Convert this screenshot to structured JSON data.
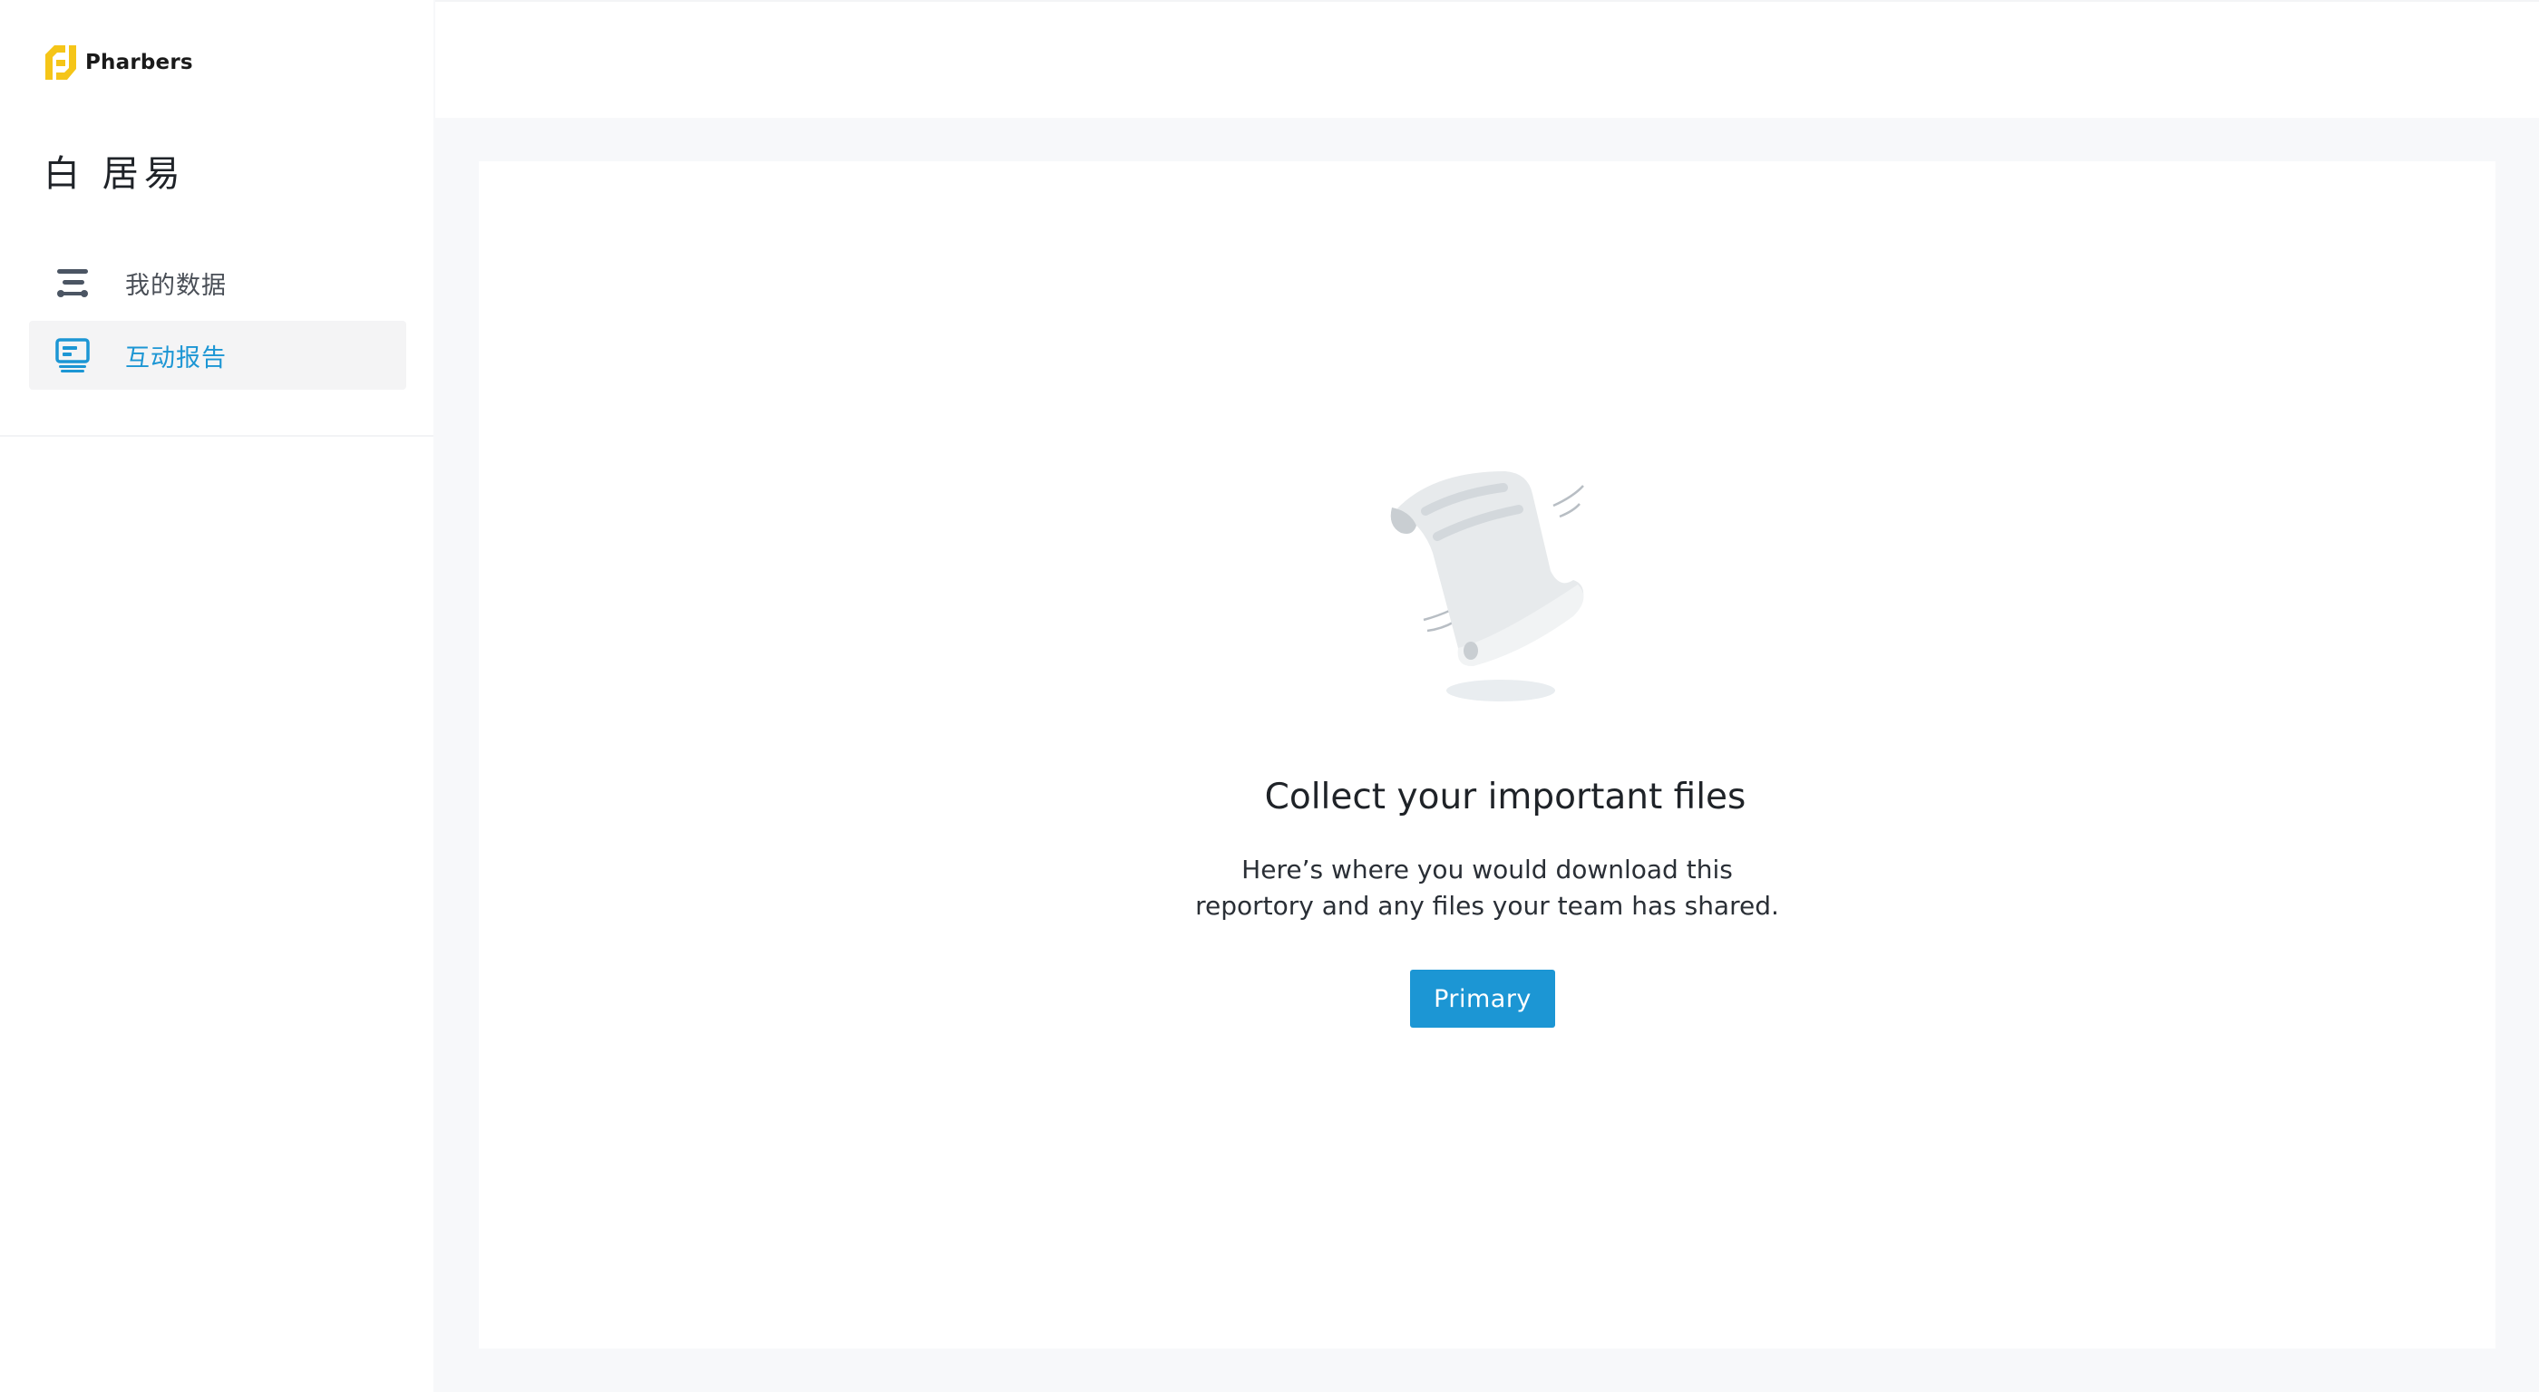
{
  "brand": {
    "name": "Pharbers",
    "logo_icon": "pharbers-logo-icon",
    "logo_color": "#f5c518"
  },
  "user": {
    "name": "白 居易"
  },
  "sidebar": {
    "items": [
      {
        "label": "我的数据",
        "icon": "data-flow-icon",
        "active": false
      },
      {
        "label": "互动报告",
        "icon": "report-icon",
        "active": true
      }
    ]
  },
  "empty_state": {
    "illustration": "scroll-paper-icon",
    "title": "Collect your important files",
    "description_line1": "Here’s where you would download this",
    "description_line2": "reportory and any files your team has shared.",
    "button_label": "Primary"
  },
  "colors": {
    "accent": "#1c96d4",
    "active_bg": "#f4f4f5",
    "page_bg": "#f7f8fa"
  }
}
